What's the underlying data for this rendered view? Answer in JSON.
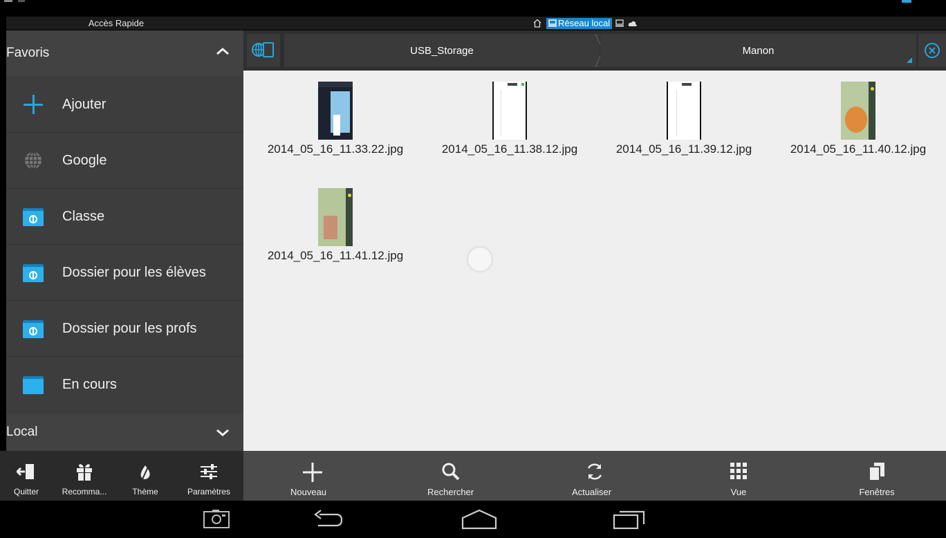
{
  "window": {
    "left_header": "Accès Rapide",
    "network_label": "Réseau local"
  },
  "sidebar": {
    "favorites_header": "Favoris",
    "local_header": "Local",
    "items": [
      {
        "label": "Ajouter",
        "icon": "plus-icon"
      },
      {
        "label": "Google",
        "icon": "globe-icon"
      },
      {
        "label": "Classe",
        "icon": "network-folder-icon"
      },
      {
        "label": "Dossier pour les élèves",
        "icon": "network-folder-icon"
      },
      {
        "label": "Dossier pour les profs",
        "icon": "network-folder-icon"
      },
      {
        "label": "En cours",
        "icon": "folder-icon"
      }
    ]
  },
  "left_toolbar": {
    "quit": "Quitter",
    "recommend": "Recomma...",
    "theme": "Thème",
    "settings": "Paramètres"
  },
  "pathbar": {
    "crumb1": "USB_Storage",
    "crumb2": "Manon"
  },
  "files": [
    {
      "name": "2014_05_16_11.33.22.jpg"
    },
    {
      "name": "2014_05_16_11.38.12.jpg"
    },
    {
      "name": "2014_05_16_11.39.12.jpg"
    },
    {
      "name": "2014_05_16_11.40.12.jpg"
    },
    {
      "name": "2014_05_16_11.41.12.jpg"
    }
  ],
  "right_toolbar": {
    "new": "Nouveau",
    "search": "Rechercher",
    "refresh": "Actualiser",
    "view": "Vue",
    "windows": "Fenêtres"
  },
  "colors": {
    "accent": "#2aa4d8",
    "folder": "#2bb1ec",
    "file_area_bg": "#efefef"
  }
}
